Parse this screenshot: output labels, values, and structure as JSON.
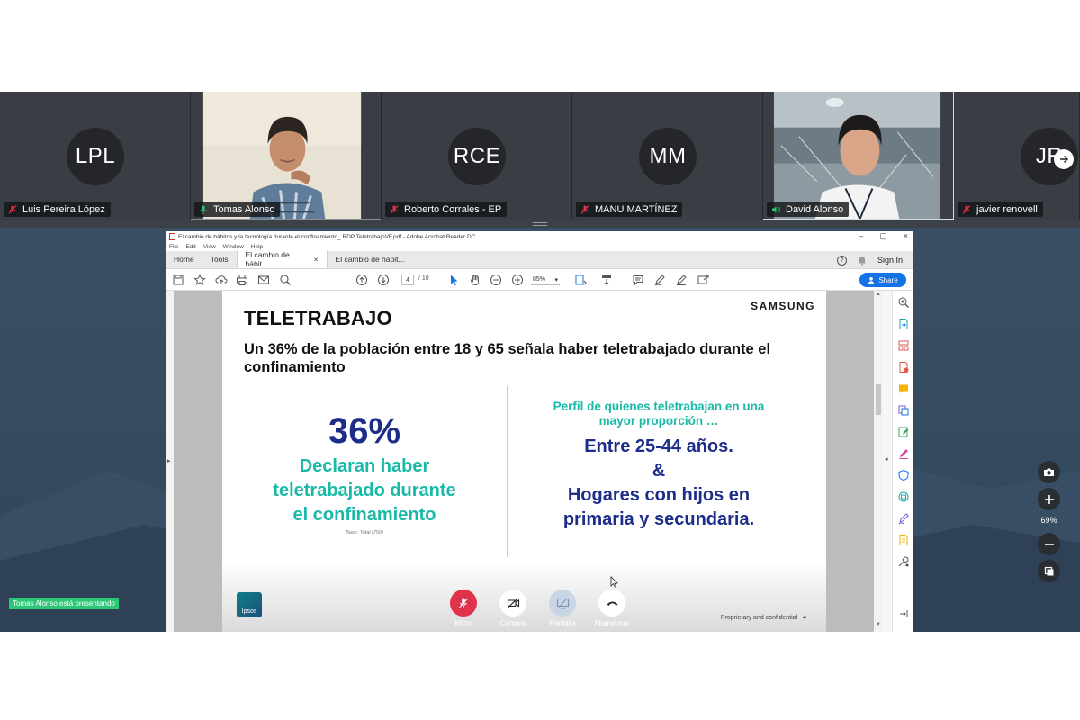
{
  "participants": [
    {
      "name": "Luis Pereira López",
      "initials": "LPL",
      "muted": true,
      "video": false
    },
    {
      "name": "Tomas Alonso",
      "initials": "",
      "muted": false,
      "video": true
    },
    {
      "name": "Roberto Corrales - EP",
      "initials": "RCE",
      "muted": true,
      "video": false
    },
    {
      "name": "MANU MARTÍNEZ",
      "initials": "MM",
      "muted": true,
      "video": false
    },
    {
      "name": "David Alonso",
      "initials": "",
      "muted": false,
      "speaking": true,
      "video": true
    },
    {
      "name": "javier renovell",
      "initials": "JR",
      "muted": true,
      "video": false
    }
  ],
  "acrobat": {
    "window_title": "El cambio de hábitos y la tecnología durante el confinamiento_ RDP TeletrabajoVF.pdf - Adobe Acrobat Reader DC",
    "menu": [
      "File",
      "Edit",
      "View",
      "Window",
      "Help"
    ],
    "tabs": {
      "home": "Home",
      "tools": "Tools",
      "doc1": "El cambio de hábit...",
      "doc2": "El cambio de hábit..."
    },
    "close_tab": "×",
    "help": "?",
    "sign_in": "Sign In",
    "page_current": "4",
    "page_total": "/ 10",
    "zoom": "85%",
    "share_label": "Share"
  },
  "slide": {
    "title": "TELETRABAJO",
    "brand": "SAMSUNG",
    "subtitle": "Un 36% de la población entre 18 y 65 señala haber teletrabajado durante el confinamiento",
    "stat": "36%",
    "stat_line1": "Declaran haber",
    "stat_line2": "teletrabajado durante",
    "stat_line3": "el confinamiento",
    "base_note": "Base: Total (750)",
    "profile_line1": "Perfil de quienes teletrabajan en una",
    "profile_line2": "mayor proporción …",
    "age": "Entre 25-44 años.",
    "amp": "&",
    "homes_line1": "Hogares con hijos en",
    "homes_line2": "primaria y secundaria.",
    "logo": "Ipsos",
    "footer": "Proprietary and confidential",
    "page_number": "4"
  },
  "call": {
    "presenting_banner": "Tomas Alonso está presentando",
    "controls": {
      "mic": "Micro",
      "camera": "Cámara",
      "screen": "Pantalla",
      "leave": "Abandonar"
    },
    "zoom_level": "69%"
  },
  "colors": {
    "teal": "#19b9a8",
    "navy": "#1c2d8a",
    "mic_red": "#e0324b",
    "present_green": "#2bc776",
    "share_blue": "#1473e6"
  }
}
